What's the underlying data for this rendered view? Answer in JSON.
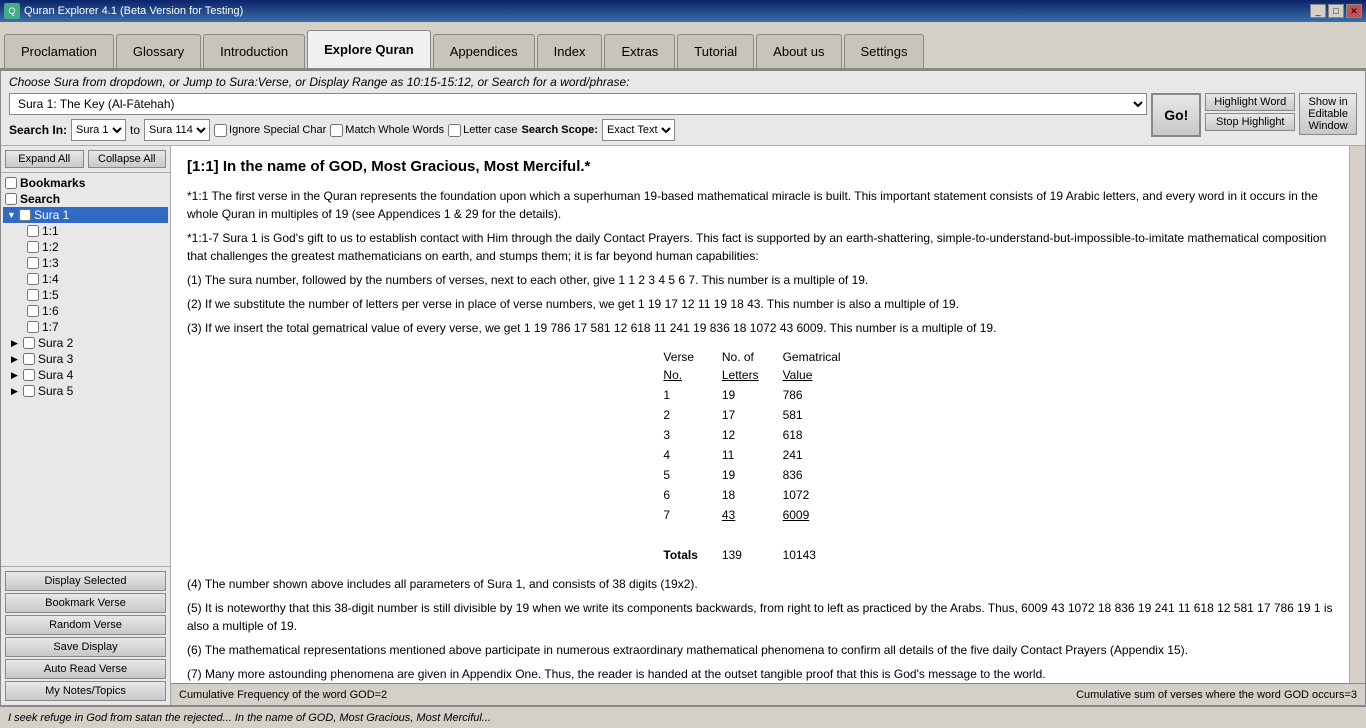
{
  "window": {
    "title": "Quran Explorer 4.1 (Beta Version for Testing)"
  },
  "tabs": [
    {
      "label": "Proclamation",
      "id": "proclamation",
      "active": false
    },
    {
      "label": "Glossary",
      "id": "glossary",
      "active": false
    },
    {
      "label": "Introduction",
      "id": "introduction",
      "active": false
    },
    {
      "label": "Explore Quran",
      "id": "explore",
      "active": true
    },
    {
      "label": "Appendices",
      "id": "appendices",
      "active": false
    },
    {
      "label": "Index",
      "id": "index",
      "active": false
    },
    {
      "label": "Extras",
      "id": "extras",
      "active": false
    },
    {
      "label": "Tutorial",
      "id": "tutorial",
      "active": false
    },
    {
      "label": "About us",
      "id": "about",
      "active": false
    },
    {
      "label": "Settings",
      "id": "settings",
      "active": false
    }
  ],
  "toolbar": {
    "instruction": "Choose Sura from dropdown, or Jump to Sura:Verse, or Display Range as 10:15-15:12, or Search for a word/phrase:",
    "sura_selected": "Sura 1:  The Key (Al-Fātehah)",
    "search_from": "Sura 1",
    "search_to": "Sura 114",
    "go_label": "Go!",
    "highlight_word": "Highlight Word",
    "stop_highlight": "Stop Highlight",
    "show_in_editable": "Show in",
    "editable_window": "Editable",
    "window_label": "Window",
    "ignore_special_char": "Ignore Special Char",
    "match_whole_words": "Match Whole Words",
    "letter_case": "Letter case",
    "search_scope_label": "Search Scope:",
    "search_scope_value": "Exact Text"
  },
  "tree": {
    "expand_all": "Expand All",
    "collapse_all": "Collapse All",
    "bookmarks_label": "Bookmarks",
    "search_label": "Search",
    "sura1_label": "Sura 1",
    "verses": [
      "1:1",
      "1:2",
      "1:3",
      "1:4",
      "1:5",
      "1:6",
      "1:7"
    ],
    "sura2_label": "Sura 2",
    "sura3_label": "Sura 3",
    "sura4_label": "Sura 4",
    "sura5_label": "Sura 5"
  },
  "bottom_buttons": [
    "Display Selected",
    "Bookmark Verse",
    "Random Verse",
    "Save Display",
    "Auto Read Verse",
    "My Notes/Topics"
  ],
  "content": {
    "verse_heading": "[1:1] In the name of GOD, Most Gracious, Most Merciful.*",
    "text_blocks": [
      "*1:1 The first verse in the Quran represents the foundation upon which a superhuman 19-based mathematical miracle is built. This important statement consists of 19 Arabic letters, and every word in it occurs in the whole Quran in multiples of 19 (see Appendices 1 & 29 for the details).",
      "*1:1-7 Sura 1 is God's gift to us to establish contact with Him through the daily Contact Prayers. This fact is supported by an earth-shattering, simple-to-understand-but-impossible-to-imitate mathematical composition that challenges the greatest mathematicians on earth, and stumps them; it is far beyond human capabilities:",
      "(1) The sura number, followed by the numbers of verses, next to each other, give 1 1 2 3 4 5 6 7. This number is a multiple of 19.",
      "(2) If we substitute the number of letters per verse in place of verse numbers, we get 1 19 17 12 11 19 18 43. This number is also a multiple of 19.",
      "(3) If we insert the total gematrical value of every verse, we get 1 19 786 17 581 12 618 11 241 19 836 18 1072 43 6009. This number is a multiple of 19."
    ],
    "table": {
      "headers": [
        "Verse\nNo.",
        "No. of\nLetters",
        "Gematrical\nValue"
      ],
      "rows": [
        [
          "1",
          "19",
          "786"
        ],
        [
          "2",
          "17",
          "581"
        ],
        [
          "3",
          "12",
          "618"
        ],
        [
          "4",
          "11",
          "241"
        ],
        [
          "5",
          "19",
          "836"
        ],
        [
          "6",
          "18",
          "1072"
        ],
        [
          "7",
          "43",
          "6009"
        ]
      ],
      "totals": [
        "Totals",
        "139",
        "10143"
      ]
    },
    "text_blocks2": [
      "(4) The number shown above includes all parameters of Sura 1, and consists of 38 digits (19x2).",
      "(5) It is noteworthy that this 38-digit number is still divisible by 19 when we write its components backwards, from right to left as practiced by the Arabs. Thus, 6009 43 1072 18 836 19 241 11 618 12 581 17 786 19 1 is also a multiple of 19.",
      "(6) The mathematical representations mentioned above participate in numerous extraordinary mathematical phenomena to confirm all details of the five daily Contact Prayers (Appendix 15).",
      "(7) Many more astounding phenomena are given in Appendix One. Thus, the reader is handed at the outset tangible proof that this is God's message to the world."
    ]
  },
  "status_bar": {
    "left": "Cumulative Frequency of the word GOD=2",
    "right": "Cumulative sum of verses where the word GOD occurs=3"
  },
  "bottom_marquee": "I seek refuge in God from satan the rejected...  In the name of GOD, Most Gracious, Most Merciful..."
}
